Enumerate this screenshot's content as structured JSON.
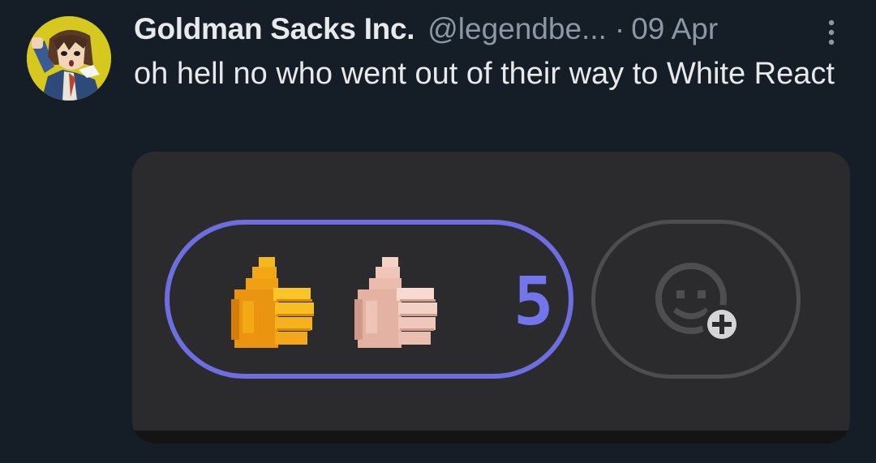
{
  "author": {
    "name": "Goldman Sacks Inc.",
    "handle": "@legendbe...",
    "separator": "·",
    "date": "09 Apr",
    "avatar_icon": "anime-character-avatar"
  },
  "tweet": {
    "text": "oh hell no who went out of their way to White React"
  },
  "media": {
    "reactions": [
      {
        "icon": "thumbs-up-yellow-icon"
      },
      {
        "icon": "thumbs-up-light-skin-icon"
      }
    ],
    "reaction_count": "5",
    "add_reaction_icon": "add-reaction-icon"
  },
  "colors": {
    "background": "#151d26",
    "pill_border": "#6d6ee0",
    "count": "#7275ec",
    "media_bg": "#2b2b2d"
  }
}
